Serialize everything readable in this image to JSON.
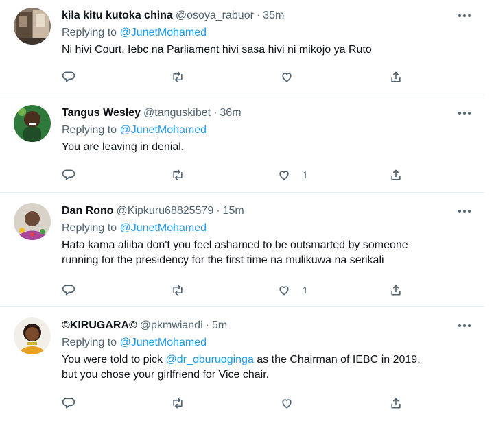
{
  "replies": [
    {
      "name": "kila kitu kutoka china",
      "handle": "@osoya_rabuor",
      "time": "35m",
      "replying_prefix": "Replying to",
      "replying_to": "@JunetMohamed",
      "text_parts": [
        "Ni hivi Court, Iebc na Parliament hivi sasa hivi ni mikojo ya Ruto"
      ],
      "like_count": ""
    },
    {
      "name": "Tangus Wesley",
      "handle": "@tanguskibet",
      "time": "36m",
      "replying_prefix": "Replying to",
      "replying_to": "@JunetMohamed",
      "text_parts": [
        "You are leaving in denial."
      ],
      "like_count": "1"
    },
    {
      "name": "Dan Rono",
      "handle": "@Kipkuru68825579",
      "time": "15m",
      "replying_prefix": "Replying to",
      "replying_to": "@JunetMohamed",
      "text_parts": [
        "Hata kama aliiba don't you feel ashamed to be outsmarted by someone",
        "running for the presidency for the first time na mulikuwa na serikali"
      ],
      "like_count": "1"
    },
    {
      "name": "©KIRUGARA©",
      "handle": "@pkmwiandi",
      "time": "5m",
      "replying_prefix": "Replying to",
      "replying_to": "@JunetMohamed",
      "text_before": "You were told to pick ",
      "text_mention": "@dr_oburuoginga",
      "text_after": " as the Chairman of IEBC in 2019,",
      "text_line2": "but you chose your girlfriend for Vice chair.",
      "like_count": ""
    }
  ],
  "separator": "·",
  "colors": {
    "link": "#1d9bf0",
    "secondary": "#536471",
    "divider": "#e6ecf0"
  },
  "icons": [
    "reply-icon",
    "retweet-icon",
    "like-icon",
    "share-icon",
    "more-icon"
  ]
}
